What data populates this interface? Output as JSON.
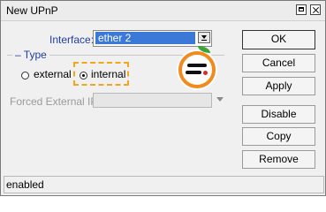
{
  "window": {
    "title": "New UPnP"
  },
  "form": {
    "interface_label": "Interface:",
    "interface_value": "ether 2",
    "type_legend": "Type",
    "type_options": [
      "external",
      "internal"
    ],
    "type_selected": "internal",
    "forced_ip_label": "Forced External IP:",
    "forced_ip_value": ""
  },
  "buttons": {
    "ok": "OK",
    "cancel": "Cancel",
    "apply": "Apply",
    "disable": "Disable",
    "copy": "Copy",
    "remove": "Remove"
  },
  "status": {
    "text": "enabled"
  },
  "colors": {
    "highlight": "#f3a51b",
    "selection": "#3b78d8",
    "label_blue": "#1f3fa0"
  },
  "icons": [
    "maximize-icon",
    "close-icon",
    "dropdown-arrow-icon",
    "watermark-logo"
  ]
}
